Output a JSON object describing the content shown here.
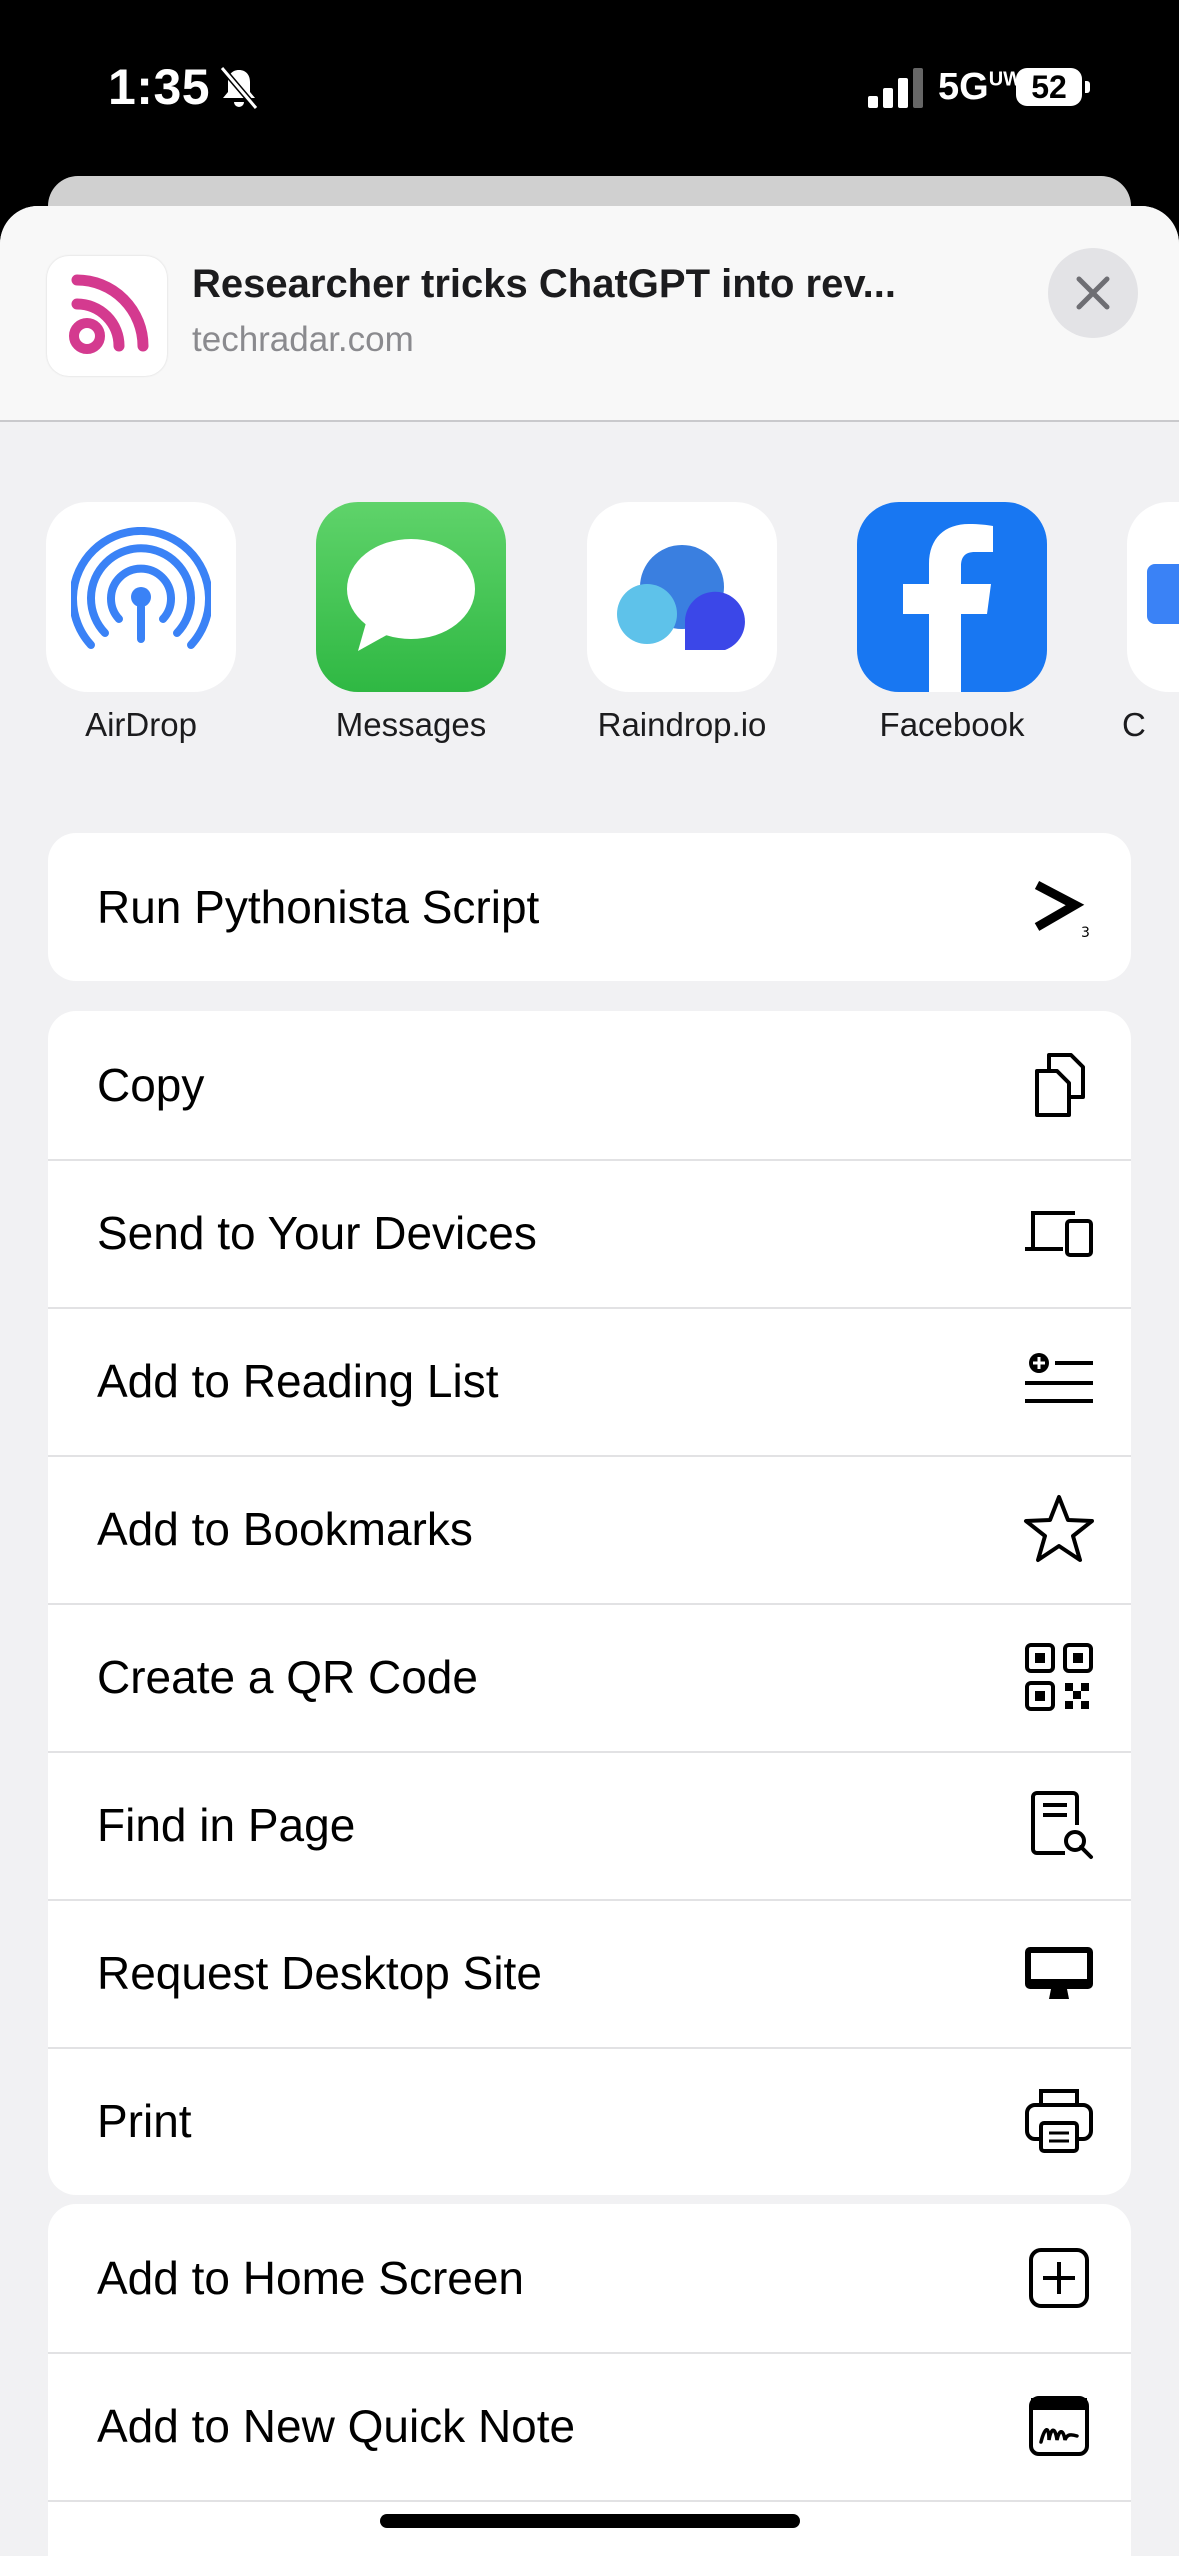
{
  "status": {
    "time": "1:35",
    "network": "5G",
    "network_suffix": "UW",
    "battery": "52"
  },
  "header": {
    "title": "Researcher tricks ChatGPT into rev...",
    "domain": "techradar.com"
  },
  "apps": [
    {
      "label": "AirDrop",
      "icon": "airdrop-icon"
    },
    {
      "label": "Messages",
      "icon": "messages-icon"
    },
    {
      "label": "Raindrop.io",
      "icon": "raindrop-icon"
    },
    {
      "label": "Facebook",
      "icon": "facebook-icon"
    },
    {
      "label": "C",
      "icon": "partial-app-icon"
    }
  ],
  "groups": {
    "g1": [
      "Run Pythonista Script"
    ],
    "g2": [
      "Copy",
      "Send to Your Devices",
      "Add to Reading List",
      "Add to Bookmarks",
      "Create a QR Code",
      "Find in Page",
      "Request Desktop Site",
      "Print"
    ],
    "g3": [
      "Add to Home Screen",
      "Add to New Quick Note"
    ]
  },
  "colors": {
    "rss": "#d43a8f",
    "messages": "#34c759",
    "facebook": "#1877f2",
    "airdrop": "#3a82f6"
  }
}
